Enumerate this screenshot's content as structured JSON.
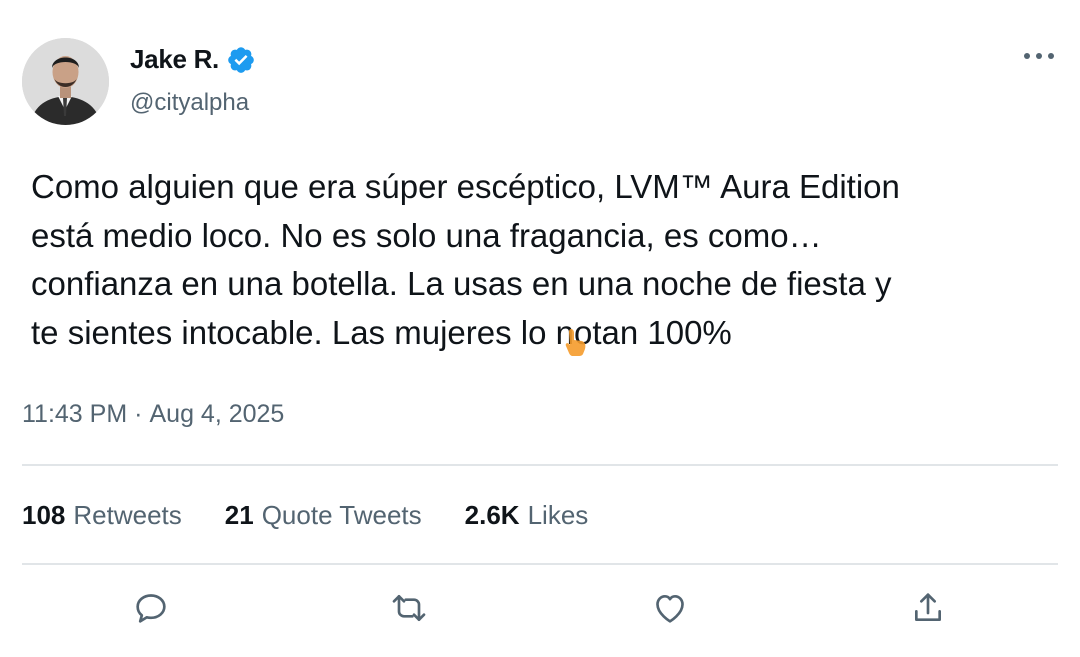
{
  "author": {
    "name": "Jake R.",
    "handle": "@cityalpha",
    "verified": true,
    "verified_color": "#1d9bf0"
  },
  "tweet": {
    "text_lines": [
      "Como alguien que era súper escéptico, LVM™ Aura Edition",
      "está medio loco. No es solo una fragancia, es como…",
      "confianza en una botella. La usas en una noche de fiesta y",
      "te sientes intocable. Las mujeres lo notan 100%"
    ],
    "time": "11:43 PM",
    "separator": "·",
    "date": "Aug 4, 2025"
  },
  "stats": {
    "retweets_count": "108",
    "retweets_label": "Retweets",
    "quotes_count": "21",
    "quotes_label": "Quote Tweets",
    "likes_count": "2.6K",
    "likes_label": "Likes"
  },
  "icons": {
    "reply": "reply-icon",
    "retweet": "retweet-icon",
    "like": "heart-icon",
    "share": "share-icon",
    "more": "more-options-icon"
  },
  "colors": {
    "text_primary": "#0f1419",
    "text_secondary": "#536471",
    "divider": "#e1e5e8"
  }
}
